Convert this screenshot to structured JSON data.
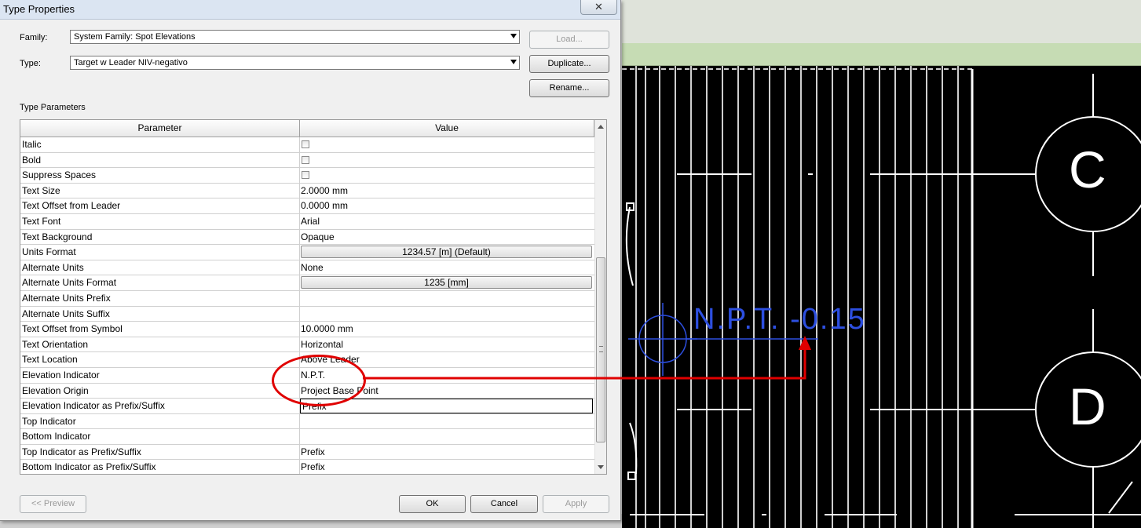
{
  "dialog": {
    "title": "Type Properties",
    "close_icon": "close-icon"
  },
  "family": {
    "label": "Family:",
    "value": "System Family: Spot Elevations"
  },
  "type": {
    "label": "Type:",
    "value": "Target w Leader NIV-negativo"
  },
  "buttons": {
    "load": "Load...",
    "duplicate": "Duplicate...",
    "rename": "Rename...",
    "preview": "<< Preview",
    "ok": "OK",
    "cancel": "Cancel",
    "apply": "Apply"
  },
  "type_parameters": {
    "label": "Type Parameters",
    "columns": [
      "Parameter",
      "Value"
    ],
    "rows": [
      {
        "parameter": "Italic",
        "value": "",
        "kind": "checkbox"
      },
      {
        "parameter": "Bold",
        "value": "",
        "kind": "checkbox"
      },
      {
        "parameter": "Suppress Spaces",
        "value": "",
        "kind": "checkbox"
      },
      {
        "parameter": "Text Size",
        "value": "2.0000 mm",
        "kind": "text"
      },
      {
        "parameter": "Text Offset from Leader",
        "value": "0.0000 mm",
        "kind": "text"
      },
      {
        "parameter": "Text Font",
        "value": "Arial",
        "kind": "text"
      },
      {
        "parameter": "Text Background",
        "value": "Opaque",
        "kind": "text"
      },
      {
        "parameter": "Units Format",
        "value": "1234.57 [m] (Default)",
        "kind": "button"
      },
      {
        "parameter": "Alternate Units",
        "value": "None",
        "kind": "text"
      },
      {
        "parameter": "Alternate Units Format",
        "value": "1235 [mm]",
        "kind": "button"
      },
      {
        "parameter": "Alternate Units Prefix",
        "value": "",
        "kind": "text"
      },
      {
        "parameter": "Alternate Units Suffix",
        "value": "",
        "kind": "text"
      },
      {
        "parameter": "Text Offset from Symbol",
        "value": "10.0000 mm",
        "kind": "text"
      },
      {
        "parameter": "Text Orientation",
        "value": "Horizontal",
        "kind": "text"
      },
      {
        "parameter": "Text Location",
        "value": "Above Leader",
        "kind": "text"
      },
      {
        "parameter": "Elevation Indicator",
        "value": "N.P.T.",
        "kind": "text"
      },
      {
        "parameter": "Elevation Origin",
        "value": "Project Base Point",
        "kind": "text"
      },
      {
        "parameter": "Elevation Indicator as Prefix/Suffix",
        "value": "Prefix",
        "kind": "select"
      },
      {
        "parameter": "Top Indicator",
        "value": "",
        "kind": "text"
      },
      {
        "parameter": "Bottom Indicator",
        "value": "",
        "kind": "text"
      },
      {
        "parameter": "Top Indicator as Prefix/Suffix",
        "value": "Prefix",
        "kind": "text"
      },
      {
        "parameter": "Bottom Indicator as Prefix/Suffix",
        "value": "Prefix",
        "kind": "text"
      }
    ]
  },
  "drawing": {
    "spot_elevation_label": "N.P.T. -0.15",
    "grid_bubbles": [
      "C",
      "D"
    ],
    "label_color": "#2d4fe0",
    "annotation_color": "#e00000"
  }
}
